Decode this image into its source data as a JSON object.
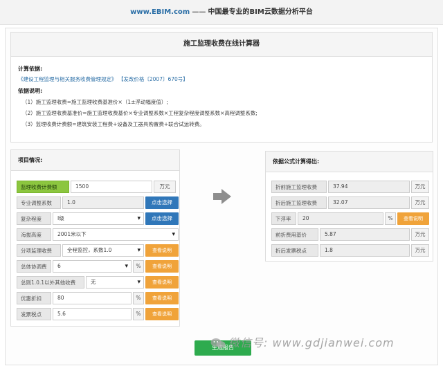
{
  "site": {
    "brand": "www.EBIM.com",
    "separator": "——",
    "slogan": "中国最专业的BIM云数据分析平台"
  },
  "calculator": {
    "title": "施工监理收费在线计算器"
  },
  "basis": {
    "heading": "计算依据:",
    "reference_doc": "《建设工程监理与相关服务收费管理规定》",
    "reference_num": "【发改价格〔2007〕670号】",
    "notes_heading": "依据说明:",
    "notes": [
      "（1）施工监理收费=施工监理收费基准价×（1±浮动幅度值）;",
      "（2）施工监理收费基准价=施工监理收费基价×专业调整系数×工程复杂程度调整系数×高程调整系数;",
      "（3）监理收费计费额=建筑安装工程费+设备及工器具购置费+联合试运转费。"
    ]
  },
  "project": {
    "title": "项目情况:",
    "fee_base": {
      "label": "监理收费计费额",
      "value": "1500",
      "unit": "万元"
    },
    "specialty": {
      "label": "专业调整系数",
      "value": "1.0",
      "button": "点击选择"
    },
    "complexity": {
      "label": "复杂程度",
      "value": "Ⅰ级",
      "button": "点击选择"
    },
    "altitude": {
      "label": "海拔高度",
      "value": "2001米以下"
    },
    "phase": {
      "label": "分项监理收费",
      "value": "全程监控，系数1.0",
      "button": "查看说明"
    },
    "overall": {
      "label": "总体协调费",
      "value": "6",
      "unit": "%",
      "button": "查看说明"
    },
    "other": {
      "label": "总则1.0.1以外其他收费",
      "value": "无",
      "button": "查看说明"
    },
    "discount": {
      "label": "优惠折扣",
      "value": "80",
      "unit": "%",
      "button": "查看说明"
    },
    "tax": {
      "label": "发票税点",
      "value": "5.6",
      "unit": "%",
      "button": "查看说明"
    }
  },
  "result": {
    "title": "依据公式计算得出:",
    "before": {
      "label": "折前施工监理收费",
      "value": "37.94",
      "unit": "万元"
    },
    "after": {
      "label": "折后施工监理收费",
      "value": "32.07",
      "unit": "万元"
    },
    "float": {
      "label": "下浮率",
      "value": "20",
      "unit": "%",
      "button": "查看说明"
    },
    "pre_base": {
      "label": "前折费用基价",
      "value": "5.87",
      "unit": "万元"
    },
    "tax_amount": {
      "label": "折后发票税点",
      "value": "1.8",
      "unit": "万元"
    }
  },
  "actions": {
    "generate": "生成报告"
  },
  "watermark": "微信号: www.gdjianwei.com",
  "colors": {
    "blue_button": "#3077b9",
    "orange_button": "#f0a33a",
    "green_label": "#8cc63f",
    "green_button": "#2eab4e"
  }
}
